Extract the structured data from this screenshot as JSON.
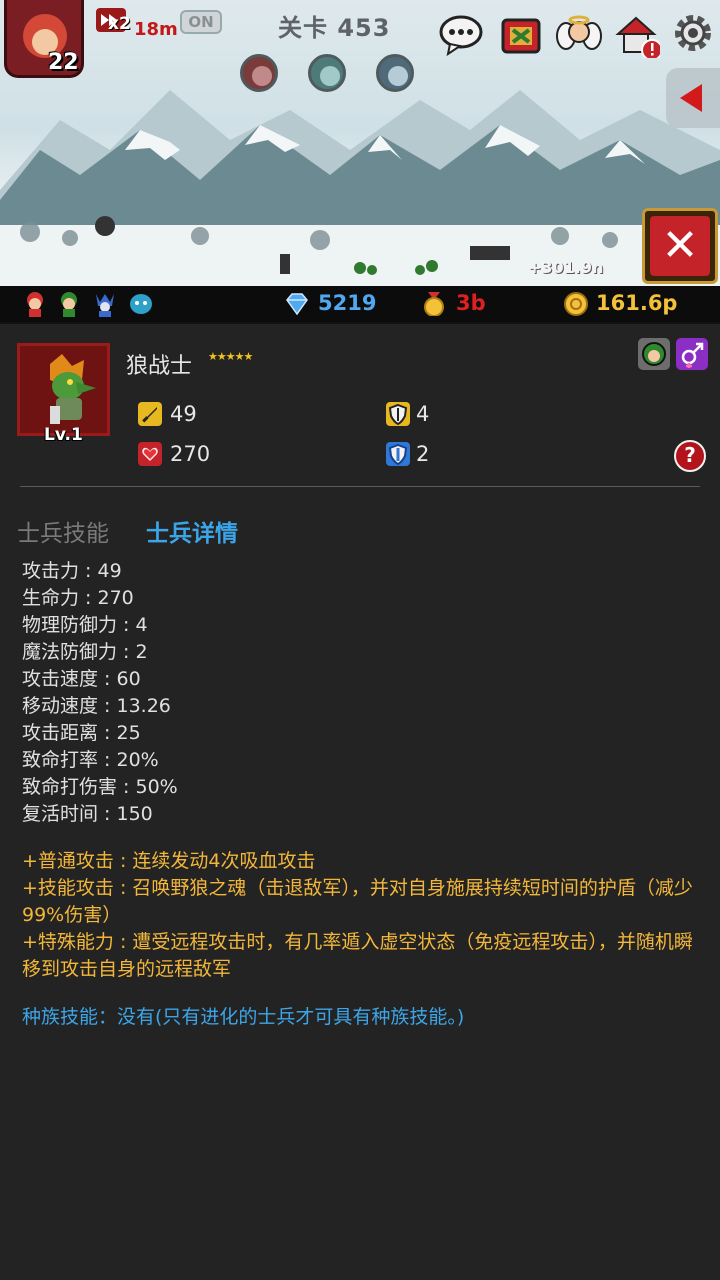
{
  "hud": {
    "hero_level": "22",
    "speed_multiplier": "x2",
    "speed_time": "18m",
    "auto_toggle": "ON",
    "stage_label": "关卡 453",
    "damage_float": "+301.9n"
  },
  "icons": {
    "chat": "chat-bubble-icon",
    "shop": "treasure-chest-icon",
    "angel": "angel-icon",
    "house": "house-alert-icon",
    "settings": "gear-icon"
  },
  "resources": {
    "gems": "5219",
    "medals": "3b",
    "gold": "161.6p",
    "colors": {
      "gems": "#4fa8f0",
      "medals": "#e02020",
      "gold": "#f3c23a"
    }
  },
  "unit": {
    "name": "狼战士",
    "stars": "★★★★★",
    "level": "Lv.1",
    "attack": "49",
    "hp": "270",
    "phys_def": "4",
    "magic_def": "2"
  },
  "tabs": {
    "skills": "士兵技能",
    "details": "士兵详情"
  },
  "attributes": [
    "攻击力 : 49",
    "生命力 : 270",
    "物理防御力 : 4",
    "魔法防御力 : 2",
    "攻击速度 : 60",
    "移动速度 : 13.26",
    "攻击距离 : 25",
    "致命打率 : 20%",
    "致命打伤害 : 50%",
    "复活时间 : 150"
  ],
  "abilities": {
    "normal": "+普通攻击 : 连续发动4次吸血攻击",
    "skill": "+技能攻击 : 召唤野狼之魂（击退敌军），并对自身施展持续短时间的护盾（减少99%伤害）",
    "special": "+特殊能力 : 遭受远程攻击时，有几率遁入虚空状态（免疫远程攻击），并随机瞬移到攻击自身的远程敌军"
  },
  "race_skill": "种族技能：没有(只有进化的士兵才可具有种族技能。)"
}
